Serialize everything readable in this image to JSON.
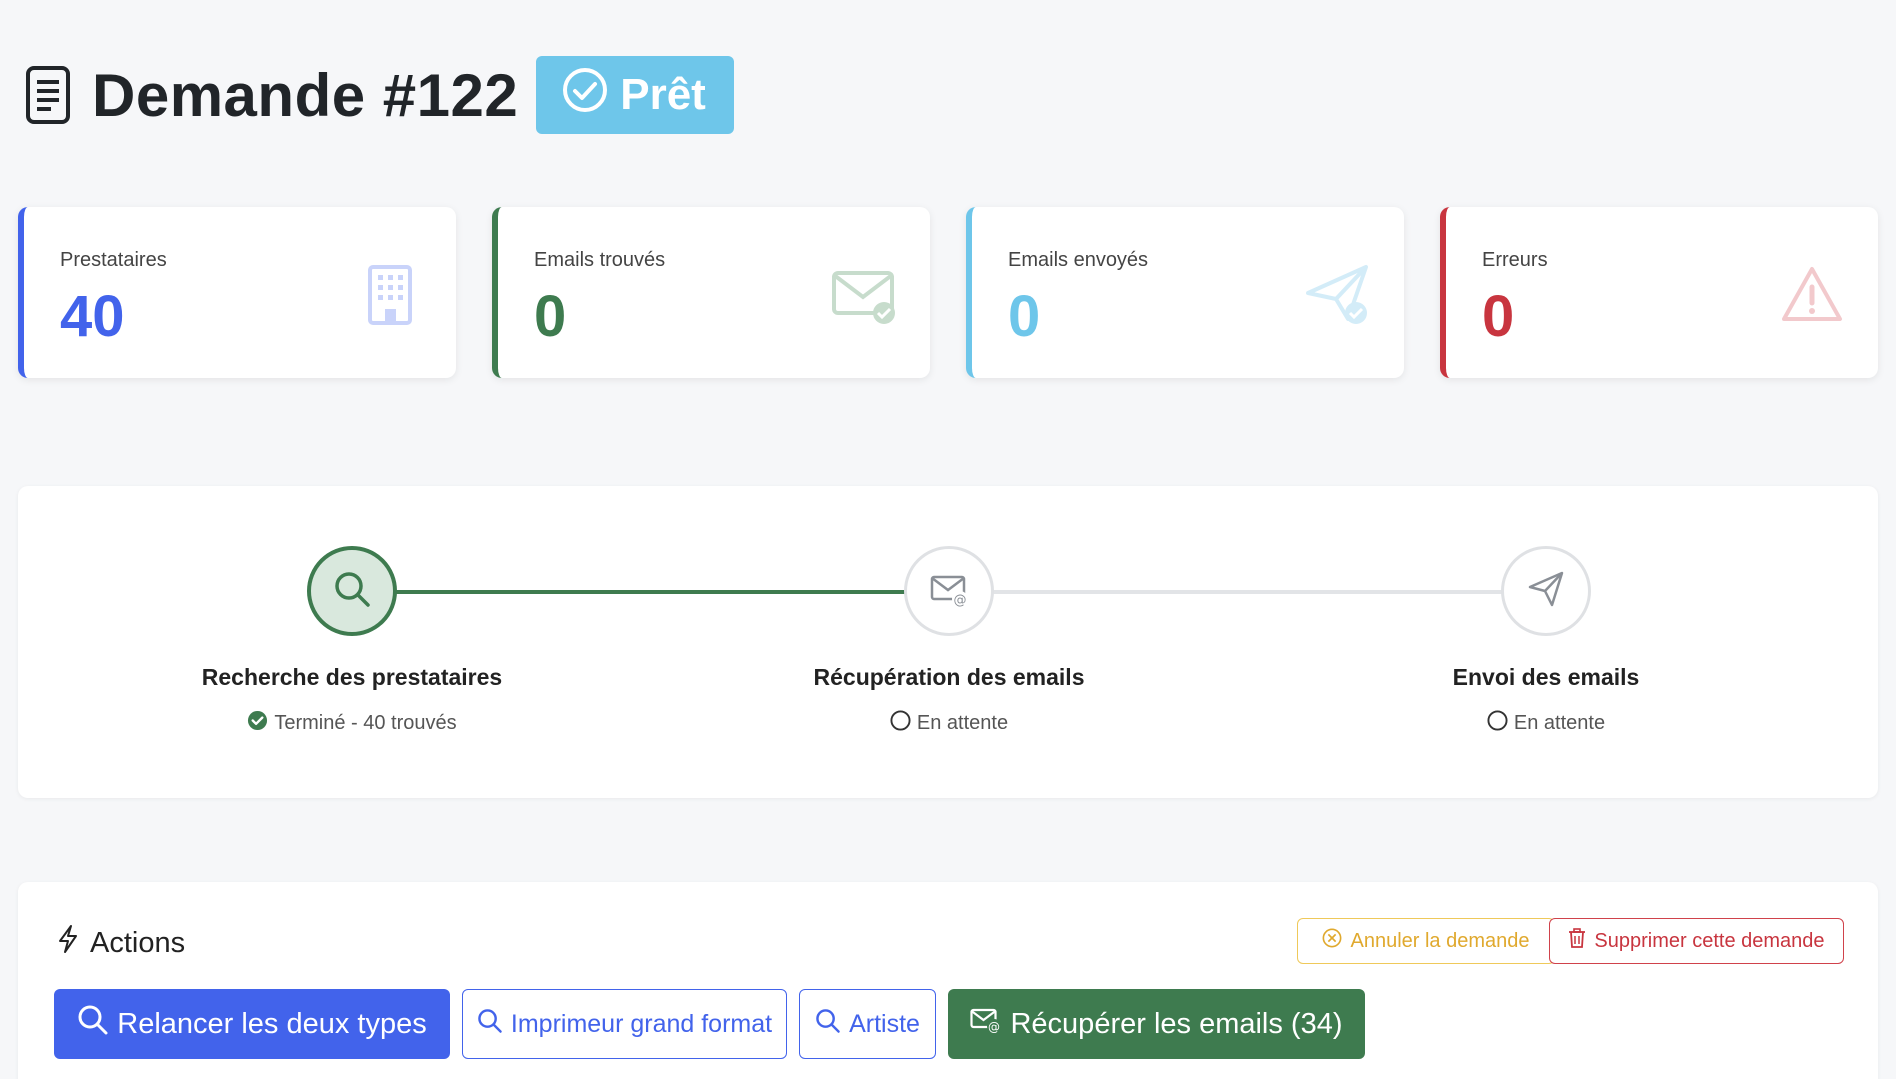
{
  "header": {
    "title": "Demande #122",
    "status_label": "Prêt",
    "status_color": "#6ec6ea"
  },
  "stats": [
    {
      "label": "Prestataires",
      "value": "40",
      "color": "#4263eb",
      "icon": "building-icon"
    },
    {
      "label": "Emails trouvés",
      "value": "0",
      "color": "#3e7b4f",
      "icon": "envelope-check-icon"
    },
    {
      "label": "Emails envoyés",
      "value": "0",
      "color": "#6ec6ea",
      "icon": "send-check-icon"
    },
    {
      "label": "Erreurs",
      "value": "0",
      "color": "#c8353f",
      "icon": "warning-icon"
    }
  ],
  "steps": [
    {
      "title": "Recherche des prestataires",
      "status": "Terminé - 40 trouvés",
      "state": "done",
      "icon": "search-icon"
    },
    {
      "title": "Récupération des emails",
      "status": "En attente",
      "state": "pending",
      "icon": "envelope-at-icon"
    },
    {
      "title": "Envoi des emails",
      "status": "En attente",
      "state": "pending",
      "icon": "send-icon"
    }
  ],
  "actions": {
    "title": "Actions",
    "cancel_label": "Annuler la demande",
    "delete_label": "Supprimer cette demande",
    "relaunch_both_label": "Relancer les deux types",
    "print_label": "Imprimeur grand format",
    "artist_label": "Artiste",
    "fetch_emails_label": "Récupérer les emails (34)"
  },
  "colors": {
    "primary": "#4263eb",
    "success": "#3e7b4f",
    "info": "#6ec6ea",
    "danger": "#c8353f",
    "warning": "#e9b949"
  }
}
